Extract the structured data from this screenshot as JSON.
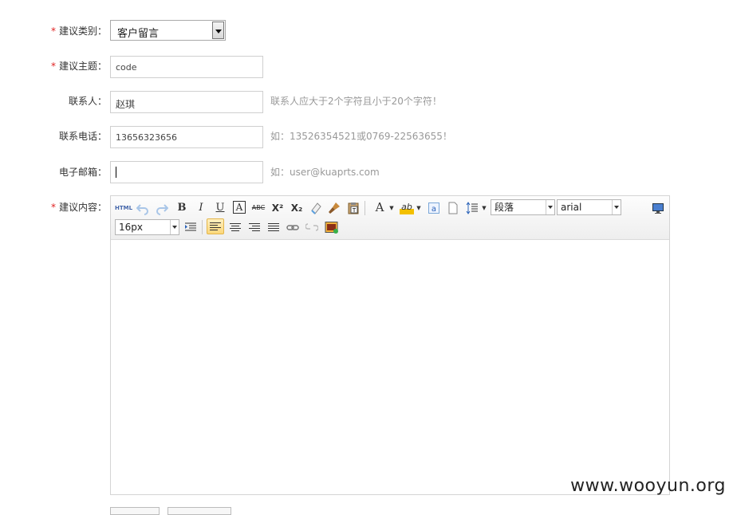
{
  "form": {
    "category": {
      "required_mark": "*",
      "label": "建议类别：",
      "value": "客户留言"
    },
    "subject": {
      "required_mark": "*",
      "label": "建议主题：",
      "value": "code"
    },
    "contact": {
      "label": "联系人：",
      "value": "赵琪",
      "hint": "联系人应大于2个字符且小于20个字符！"
    },
    "phone": {
      "label": "联系电话：",
      "value": "13656323656",
      "hint": "如：13526354521或0769-22563655！"
    },
    "email": {
      "label": "电子邮箱：",
      "value": "",
      "hint": "如：user@kuaprts.com"
    },
    "content": {
      "required_mark": "*",
      "label": "建议内容："
    }
  },
  "editor": {
    "toolbar": {
      "html_label": "HTML",
      "bold_label": "B",
      "italic_label": "I",
      "underline_label": "U",
      "fontborder_label": "A",
      "strike_label": "ABC",
      "superscript_label": "X²",
      "subscript_label": "X₂",
      "forecolor_label": "A",
      "backcolor_label": "ab",
      "paragraph_value": "段落",
      "fontfamily_value": "arial",
      "fontsize_value": "16px"
    },
    "body_text": ""
  },
  "watermark": "www.wooyun.org",
  "colors": {
    "required": "#e02222",
    "hint": "#999999",
    "active_align": "#fbd77a"
  }
}
